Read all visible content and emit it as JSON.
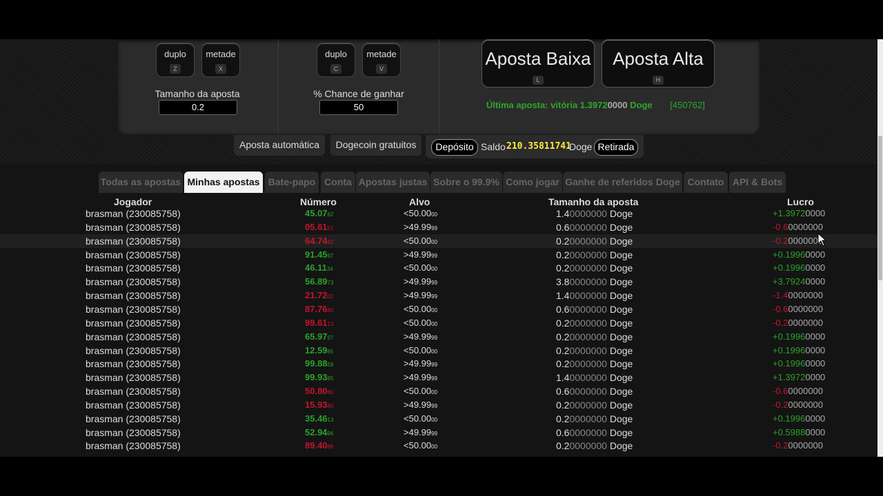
{
  "controls": {
    "bet_double": {
      "label": "duplo",
      "key": "Z"
    },
    "bet_half": {
      "label": "metade",
      "key": "X"
    },
    "bet_size_label": "Tamanho da aposta",
    "bet_size_value": "0.2",
    "chance_double": {
      "label": "duplo",
      "key": "C"
    },
    "chance_half": {
      "label": "metade",
      "key": "V"
    },
    "chance_label": "% Chance de ganhar",
    "chance_value": "50",
    "bet_low": {
      "label": "Aposta Baixa",
      "key": "L"
    },
    "bet_high": {
      "label": "Aposta Alta",
      "key": "H"
    },
    "last_bet_text": "Última aposta: vitória 1.3972",
    "last_bet_dim": "0000",
    "last_bet_unit": "Doge",
    "last_bet_id": "[450762]"
  },
  "toolbar": {
    "auto_bet": "Aposta automática",
    "free_doge": "Dogecoin gratuitos",
    "deposit": "Depósito",
    "balance_label": "Saldo",
    "balance_value": "210.35811741",
    "balance_unit": "Doge",
    "withdraw": "Retirada"
  },
  "tabs": [
    {
      "label": "Todas as apostas",
      "active": false
    },
    {
      "label": "Minhas apostas",
      "active": true
    },
    {
      "label": "Bate-papo",
      "active": false
    },
    {
      "label": "Conta",
      "active": false
    },
    {
      "label": "Apostas justas",
      "active": false
    },
    {
      "label": "Sobre o 99.9%",
      "active": false
    },
    {
      "label": "Como jogar",
      "active": false
    },
    {
      "label": "Ganhe de referidos Doge",
      "active": false
    },
    {
      "label": "Contato",
      "active": false
    },
    {
      "label": "API & Bots",
      "active": false
    }
  ],
  "table": {
    "headers": {
      "player": "Jogador",
      "number": "Número",
      "target": "Alvo",
      "size": "Tamanho da aposta",
      "profit": "Lucro"
    },
    "rows": [
      {
        "player": "brasman (230085758)",
        "number": "45.07",
        "number_small": "62",
        "win": true,
        "target": "<50.00",
        "target_small": "00",
        "size": "1.4",
        "size_dim": "0000000",
        "unit": "Doge",
        "profit": "+1.3972",
        "profit_dim": "0000"
      },
      {
        "player": "brasman (230085758)",
        "number": "05.61",
        "number_small": "51",
        "win": false,
        "target": ">49.99",
        "target_small": "99",
        "size": "0.6",
        "size_dim": "0000000",
        "unit": "Doge",
        "profit": "-0.6",
        "profit_dim": "0000000"
      },
      {
        "player": "brasman (230085758)",
        "number": "64.74",
        "number_small": "82",
        "win": false,
        "target": "<50.00",
        "target_small": "00",
        "size": "0.2",
        "size_dim": "0000000",
        "unit": "Doge",
        "profit": "-0.2",
        "profit_dim": "0000000"
      },
      {
        "player": "brasman (230085758)",
        "number": "91.45",
        "number_small": "97",
        "win": true,
        "target": ">49.99",
        "target_small": "99",
        "size": "0.2",
        "size_dim": "0000000",
        "unit": "Doge",
        "profit": "+0.1996",
        "profit_dim": "0000"
      },
      {
        "player": "brasman (230085758)",
        "number": "46.11",
        "number_small": "34",
        "win": true,
        "target": "<50.00",
        "target_small": "00",
        "size": "0.2",
        "size_dim": "0000000",
        "unit": "Doge",
        "profit": "+0.1996",
        "profit_dim": "0000"
      },
      {
        "player": "brasman (230085758)",
        "number": "56.89",
        "number_small": "73",
        "win": true,
        "target": ">49.99",
        "target_small": "99",
        "size": "3.8",
        "size_dim": "0000000",
        "unit": "Doge",
        "profit": "+3.7924",
        "profit_dim": "0000"
      },
      {
        "player": "brasman (230085758)",
        "number": "21.72",
        "number_small": "02",
        "win": false,
        "target": ">49.99",
        "target_small": "99",
        "size": "1.4",
        "size_dim": "0000000",
        "unit": "Doge",
        "profit": "-1.4",
        "profit_dim": "0000000"
      },
      {
        "player": "brasman (230085758)",
        "number": "87.76",
        "number_small": "60",
        "win": false,
        "target": "<50.00",
        "target_small": "00",
        "size": "0.6",
        "size_dim": "0000000",
        "unit": "Doge",
        "profit": "-0.6",
        "profit_dim": "0000000"
      },
      {
        "player": "brasman (230085758)",
        "number": "99.61",
        "number_small": "13",
        "win": false,
        "target": "<50.00",
        "target_small": "00",
        "size": "0.2",
        "size_dim": "0000000",
        "unit": "Doge",
        "profit": "-0.2",
        "profit_dim": "0000000"
      },
      {
        "player": "brasman (230085758)",
        "number": "65.97",
        "number_small": "97",
        "win": true,
        "target": ">49.99",
        "target_small": "99",
        "size": "0.2",
        "size_dim": "0000000",
        "unit": "Doge",
        "profit": "+0.1996",
        "profit_dim": "0000"
      },
      {
        "player": "brasman (230085758)",
        "number": "12.59",
        "number_small": "85",
        "win": true,
        "target": "<50.00",
        "target_small": "00",
        "size": "0.2",
        "size_dim": "0000000",
        "unit": "Doge",
        "profit": "+0.1996",
        "profit_dim": "0000"
      },
      {
        "player": "brasman (230085758)",
        "number": "99.88",
        "number_small": "59",
        "win": true,
        "target": ">49.99",
        "target_small": "99",
        "size": "0.2",
        "size_dim": "0000000",
        "unit": "Doge",
        "profit": "+0.1996",
        "profit_dim": "0000"
      },
      {
        "player": "brasman (230085758)",
        "number": "99.93",
        "number_small": "85",
        "win": true,
        "target": ">49.99",
        "target_small": "99",
        "size": "1.4",
        "size_dim": "0000000",
        "unit": "Doge",
        "profit": "+1.3972",
        "profit_dim": "0000"
      },
      {
        "player": "brasman (230085758)",
        "number": "50.80",
        "number_small": "80",
        "win": false,
        "target": "<50.00",
        "target_small": "00",
        "size": "0.6",
        "size_dim": "0000000",
        "unit": "Doge",
        "profit": "-0.6",
        "profit_dim": "0000000"
      },
      {
        "player": "brasman (230085758)",
        "number": "15.93",
        "number_small": "80",
        "win": false,
        "target": ">49.99",
        "target_small": "99",
        "size": "0.2",
        "size_dim": "0000000",
        "unit": "Doge",
        "profit": "-0.2",
        "profit_dim": "0000000"
      },
      {
        "player": "brasman (230085758)",
        "number": "35.46",
        "number_small": "13",
        "win": true,
        "target": "<50.00",
        "target_small": "00",
        "size": "0.2",
        "size_dim": "0000000",
        "unit": "Doge",
        "profit": "+0.1996",
        "profit_dim": "0000"
      },
      {
        "player": "brasman (230085758)",
        "number": "52.94",
        "number_small": "96",
        "win": true,
        "target": ">49.99",
        "target_small": "99",
        "size": "0.6",
        "size_dim": "0000000",
        "unit": "Doge",
        "profit": "+0.5988",
        "profit_dim": "0000"
      },
      {
        "player": "brasman (230085758)",
        "number": "89.40",
        "number_small": "88",
        "win": false,
        "target": "<50.00",
        "target_small": "00",
        "size": "0.2",
        "size_dim": "0000000",
        "unit": "Doge",
        "profit": "-0.2",
        "profit_dim": "0000000"
      }
    ]
  },
  "colors": {
    "win": "#2ca02c",
    "lose": "#c0162c",
    "balance": "#ffeb3b",
    "last_bet": "#2ea62e"
  }
}
